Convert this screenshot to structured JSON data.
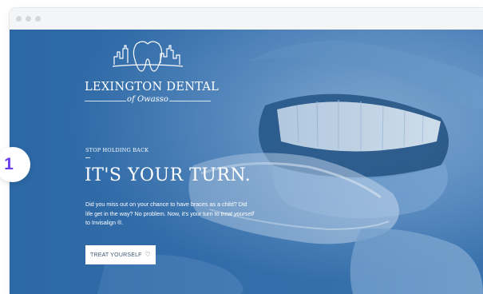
{
  "site": {
    "logo": {
      "name": "LEXINGTON DENTAL",
      "subtitle": "of Owasso",
      "icon": "tooth-skyline-icon"
    },
    "hero": {
      "eyebrow": "STOP HOLDING BACK",
      "headline": "IT'S YOUR TURN.",
      "body_before": "Did you miss out on your chance to have braces as a child? Did life get in the way? No problem. Now, it's your turn to ",
      "body_emphasis": "treat yourself",
      "body_after": " to Invisalign ®.",
      "cta_label": "TREAT YOURSELF",
      "cta_icon": "heart-outline-icon"
    }
  },
  "annotation": {
    "step_number": "1"
  },
  "colors": {
    "hero_blue": "#2f6aa6",
    "badge_text": "#6c3df0",
    "cta_text": "#3a5670"
  }
}
